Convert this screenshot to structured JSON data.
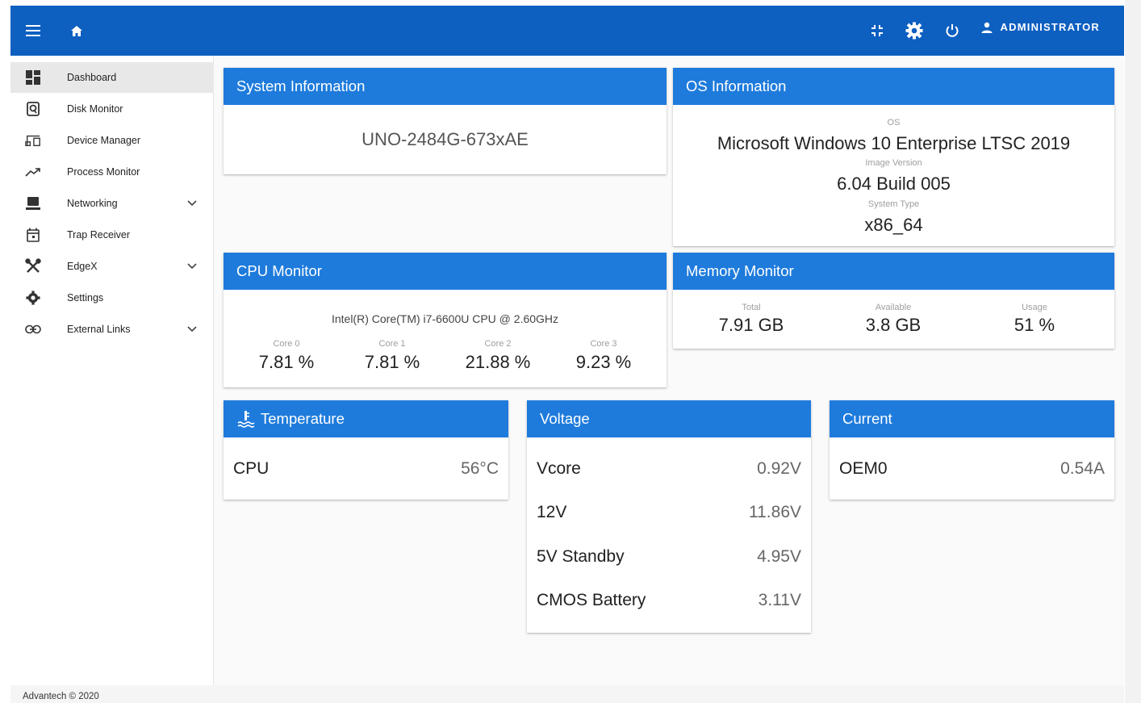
{
  "topbar": {
    "user_label": "ADMINISTRATOR"
  },
  "sidebar": {
    "items": [
      {
        "label": "Dashboard"
      },
      {
        "label": "Disk Monitor"
      },
      {
        "label": "Device Manager"
      },
      {
        "label": "Process Monitor"
      },
      {
        "label": "Networking"
      },
      {
        "label": "Trap Receiver"
      },
      {
        "label": "EdgeX"
      },
      {
        "label": "Settings"
      },
      {
        "label": "External Links"
      }
    ]
  },
  "system_info": {
    "title": "System Information",
    "model": "UNO-2484G-673xAE"
  },
  "os_info": {
    "title": "OS Information",
    "os_label": "OS",
    "os_value": "Microsoft Windows 10 Enterprise LTSC 2019",
    "image_label": "Image Version",
    "image_value": "6.04 Build 005",
    "type_label": "System Type",
    "type_value": "x86_64"
  },
  "cpu": {
    "title": "CPU Monitor",
    "model": "Intel(R) Core(TM) i7-6600U CPU @ 2.60GHz",
    "cores": [
      {
        "label": "Core 0",
        "value": "7.81 %"
      },
      {
        "label": "Core 1",
        "value": "7.81 %"
      },
      {
        "label": "Core 2",
        "value": "21.88 %"
      },
      {
        "label": "Core 3",
        "value": "9.23 %"
      }
    ]
  },
  "memory": {
    "title": "Memory Monitor",
    "total_label": "Total",
    "total_value": "7.91 GB",
    "available_label": "Available",
    "available_value": "3.8 GB",
    "usage_label": "Usage",
    "usage_value": "51 %"
  },
  "temperature": {
    "title": "Temperature",
    "rows": [
      {
        "name": "CPU",
        "value": "56°C"
      }
    ]
  },
  "voltage": {
    "title": "Voltage",
    "rows": [
      {
        "name": "Vcore",
        "value": "0.92V"
      },
      {
        "name": "12V",
        "value": "11.86V"
      },
      {
        "name": "5V Standby",
        "value": "4.95V"
      },
      {
        "name": "CMOS Battery",
        "value": "3.11V"
      }
    ]
  },
  "current": {
    "title": "Current",
    "rows": [
      {
        "name": "OEM0",
        "value": "0.54A"
      }
    ]
  },
  "footer": {
    "text": "Advantech © 2020"
  },
  "colors": {
    "topbar": "#0d5fc0",
    "card_header": "#1e7bdc"
  }
}
